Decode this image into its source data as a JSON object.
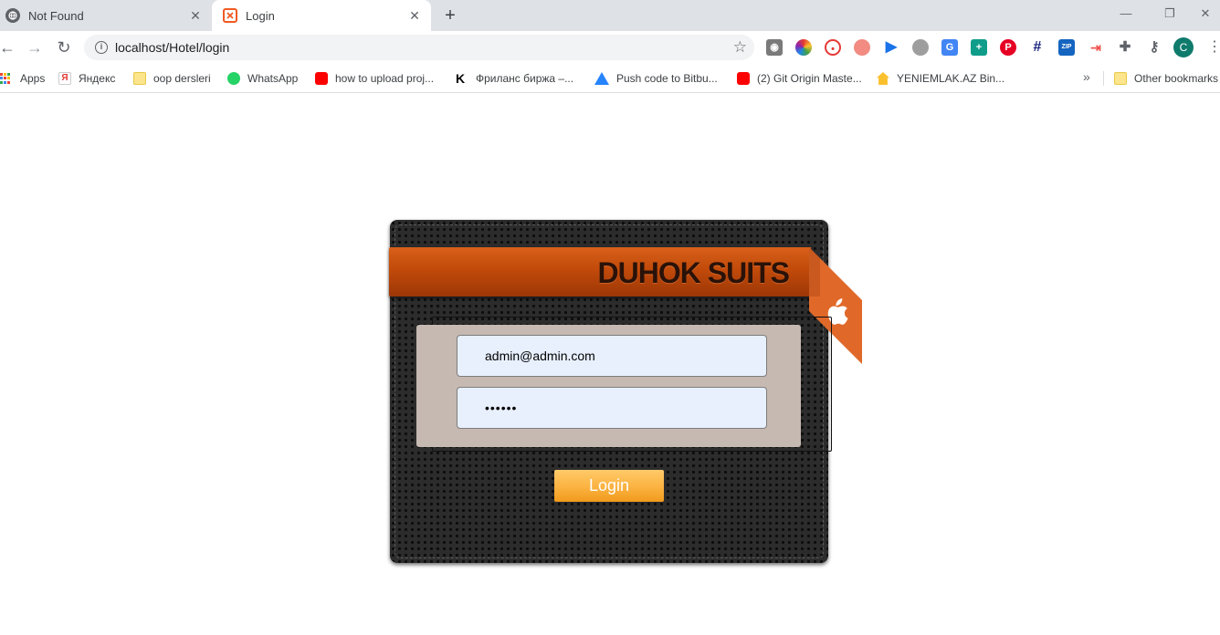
{
  "browser": {
    "tabs": [
      {
        "title": "Not Found",
        "active": false
      },
      {
        "title": "Login",
        "active": true
      }
    ],
    "new_tab_label": "+",
    "window_controls": {
      "minimize": "—",
      "restore": "❐",
      "close": "✕"
    },
    "nav": {
      "back": "←",
      "forward": "→",
      "reload": "↻"
    },
    "url": "localhost/Hotel/login",
    "profile_initial": "C",
    "bookmarks": [
      {
        "label": "Apps",
        "icon": "apps-grid-icon"
      },
      {
        "label": "Яндекс",
        "icon": "yandex-icon"
      },
      {
        "label": "oop dersleri",
        "icon": "folder-icon"
      },
      {
        "label": "WhatsApp",
        "icon": "whatsapp-icon"
      },
      {
        "label": "how to upload proj...",
        "icon": "youtube-icon"
      },
      {
        "label": "Фриланс биржа –...",
        "icon": "kwork-icon"
      },
      {
        "label": "Push code to Bitbu...",
        "icon": "atlassian-icon"
      },
      {
        "label": "(2) Git Origin Maste...",
        "icon": "youtube-icon"
      },
      {
        "label": "YENIEMLAK.AZ Bin...",
        "icon": "house-icon"
      }
    ],
    "bookmarks_overflow": "»",
    "other_bookmarks": "Other bookmarks"
  },
  "login": {
    "brand_title": "DUHOK SUITS",
    "email_value": "admin@admin.com",
    "password_value": "••••••",
    "submit_label": "Login"
  },
  "colors": {
    "ribbon": "#c24a0a",
    "flag": "#e0692a",
    "panel": "#c6b9b1",
    "field": "#e8f0fe",
    "button": "#fbb240"
  }
}
